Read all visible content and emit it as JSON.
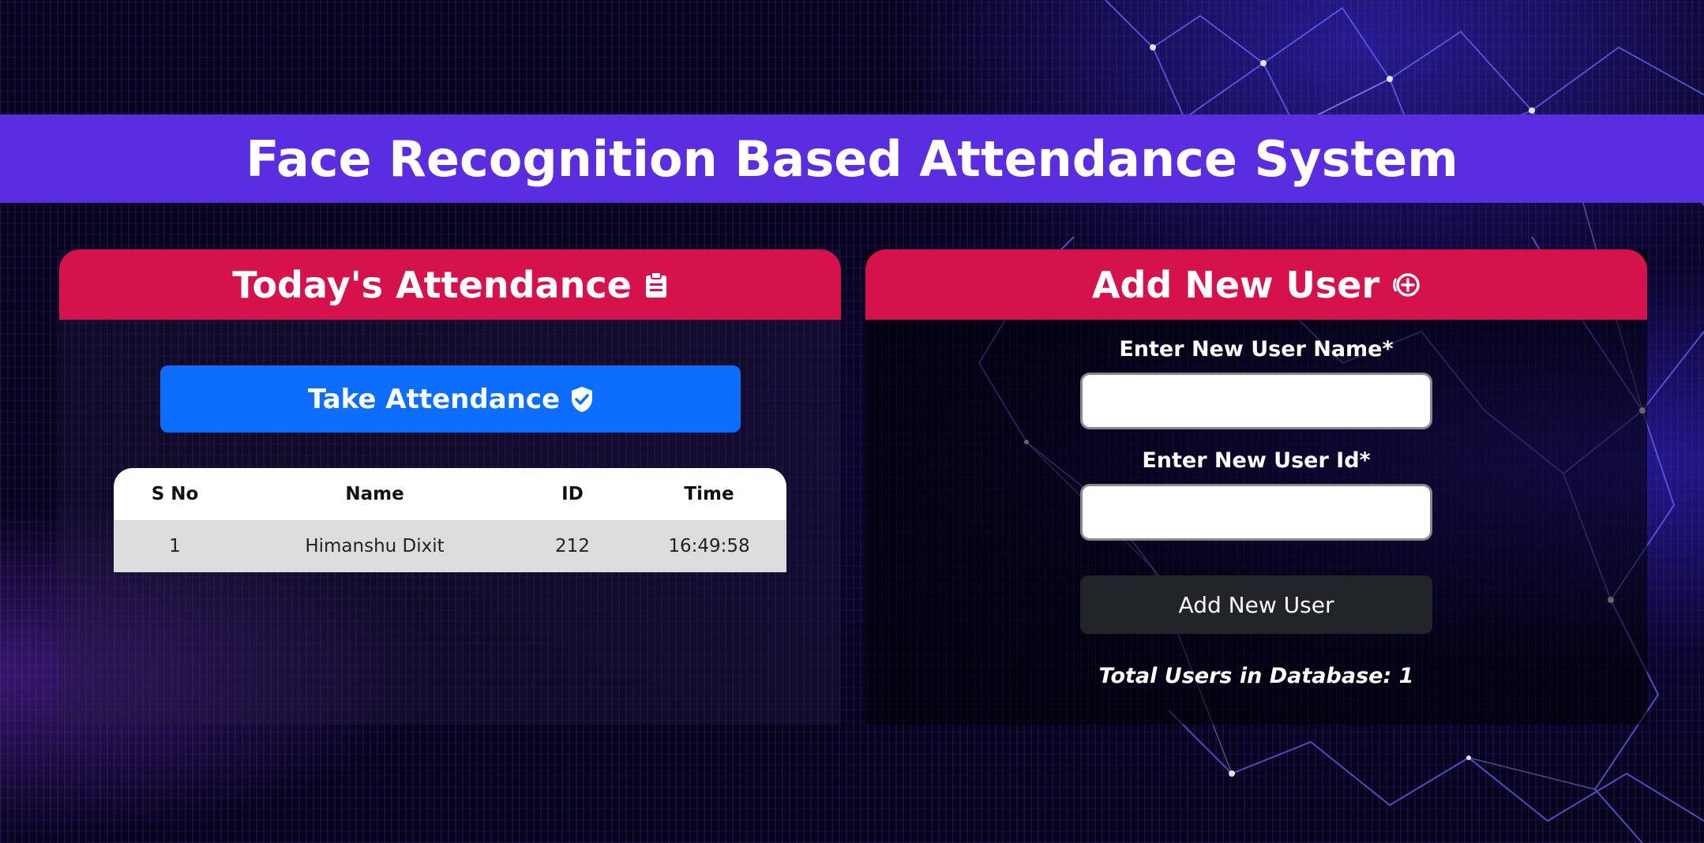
{
  "header": {
    "title": "Face Recognition Based Attendance System"
  },
  "attendance_panel": {
    "title": "Today's Attendance",
    "title_icon": "clipboard-icon",
    "take_button_label": "Take Attendance",
    "take_button_icon": "shield-check-icon",
    "table": {
      "columns": [
        "S No",
        "Name",
        "ID",
        "Time"
      ],
      "rows": [
        {
          "sno": "1",
          "name": "Himanshu Dixit",
          "id": "212",
          "time": "16:49:58"
        }
      ]
    }
  },
  "add_user_panel": {
    "title": "Add New User",
    "title_icon": "plus-circle-icon",
    "name_label": "Enter New User Name*",
    "name_value": "",
    "id_label": "Enter New User Id*",
    "id_value": "",
    "submit_label": "Add New User",
    "total_users_text": "Total Users in Database: 1"
  },
  "colors": {
    "banner": "#5a2ee0",
    "panel_header": "#d5124b",
    "primary_button": "#0d6efd",
    "dark_button": "#212529"
  }
}
